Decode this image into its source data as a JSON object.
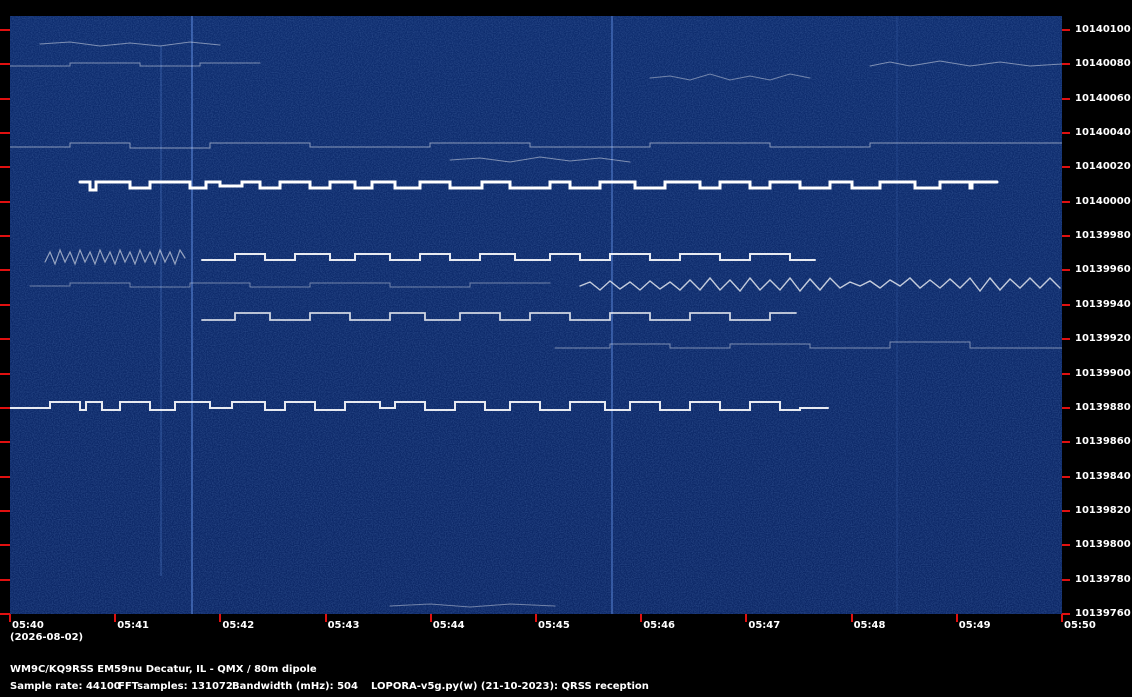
{
  "date_label": "(2026-08-02)",
  "station_info": "WM9C/KQ9RSS EM59nu Decatur, IL - QMX / 80m dipole",
  "sample_rate": "Sample rate: 44100",
  "fft_samples": "FFTsamples: 131072",
  "bandwidth": "Bandwidth (mHz): 504",
  "software": "LOPORA-v5g.py(w) (21-10-2023): QRSS reception",
  "colors": {
    "background": "#000000",
    "waterfall": "#0f2a66",
    "tick": "#e01010",
    "text": "#ffffff"
  },
  "y_axis_labels": [
    "10140100",
    "10140080",
    "10140060",
    "10140040",
    "10140020",
    "10140000",
    "10139980",
    "10139960",
    "10139940",
    "10139920",
    "10139900",
    "10139880",
    "10139860",
    "10139840",
    "10139820",
    "10139800",
    "10139780",
    "10139760"
  ],
  "x_axis_labels": [
    "05:40",
    "05:41",
    "05:42",
    "05:43",
    "05:44",
    "05:45",
    "05:46",
    "05:47",
    "05:48",
    "05:49",
    "05:50"
  ]
}
